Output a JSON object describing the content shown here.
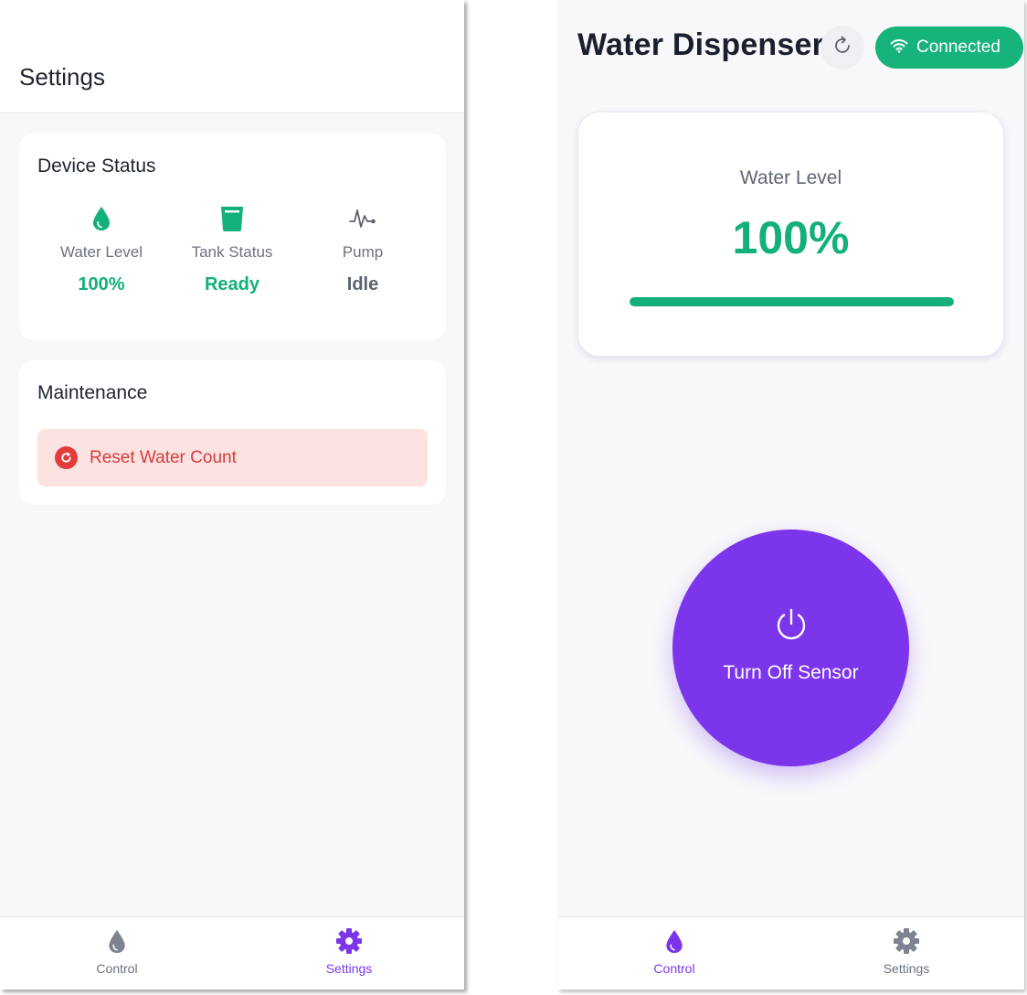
{
  "settings_screen": {
    "header": {
      "title": "Settings"
    },
    "device_status": {
      "title": "Device Status",
      "items": [
        {
          "icon": "water-drop-icon",
          "label": "Water Level",
          "value": "100%",
          "value_color": "#13b07a"
        },
        {
          "icon": "tank-icon",
          "label": "Tank Status",
          "value": "Ready",
          "value_color": "#13b07a"
        },
        {
          "icon": "pulse-icon",
          "label": "Pump",
          "value": "Idle",
          "value_color": "#5b6270"
        }
      ]
    },
    "maintenance": {
      "title": "Maintenance",
      "reset_button": {
        "icon": "reset-icon",
        "label": "Reset Water Count"
      }
    },
    "bottom_nav": {
      "items": [
        {
          "icon": "water-drop-icon",
          "label": "Control",
          "active": false
        },
        {
          "icon": "gear-icon",
          "label": "Settings",
          "active": true
        }
      ]
    }
  },
  "control_screen": {
    "header": {
      "title": "Water Dispenser",
      "refresh_icon": "refresh-icon",
      "connection": {
        "icon": "wifi-icon",
        "label": "Connected",
        "color": "#16b37a"
      }
    },
    "water_level": {
      "label": "Water Level",
      "value": "100%",
      "percent": 100
    },
    "sensor_button": {
      "icon": "power-icon",
      "label": "Turn Off Sensor",
      "color": "#7b35ea"
    },
    "bottom_nav": {
      "items": [
        {
          "icon": "water-drop-icon",
          "label": "Control",
          "active": true
        },
        {
          "icon": "gear-icon",
          "label": "Settings",
          "active": false
        }
      ]
    }
  },
  "colors": {
    "accent": "#7b35ea",
    "success": "#13b07a",
    "danger": "#e23b3b",
    "danger_bg": "#fde2e2"
  }
}
